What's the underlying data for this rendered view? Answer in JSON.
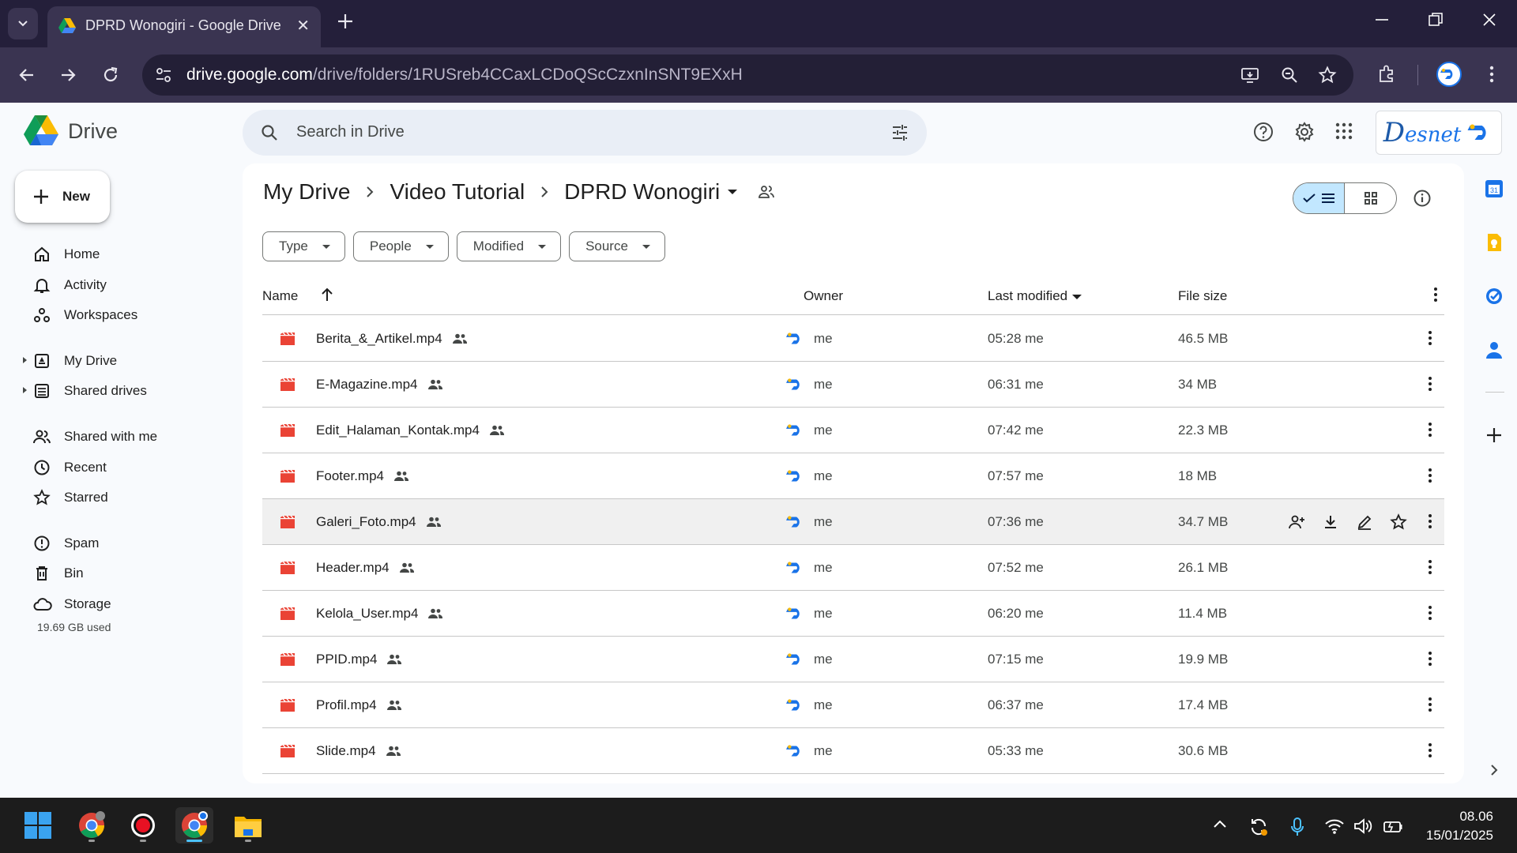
{
  "browser": {
    "tab_title": "DPRD Wonogiri - Google Drive",
    "url_host": "drive.google.com",
    "url_path": "/drive/folders/1RUSreb4CCaxLCDoQScCzxnInSNT9EXxH"
  },
  "drive": {
    "app_name": "Drive",
    "search_placeholder": "Search in Drive",
    "brand_text": "esnet",
    "brand_initial": "D",
    "new_label": "New",
    "nav": [
      {
        "label": "Home",
        "icon": "home-icon"
      },
      {
        "label": "Activity",
        "icon": "bell-icon"
      },
      {
        "label": "Workspaces",
        "icon": "workspaces-icon"
      },
      {
        "label": "My Drive",
        "icon": "my-drive-icon"
      },
      {
        "label": "Shared drives",
        "icon": "shared-drives-icon"
      },
      {
        "label": "Shared with me",
        "icon": "people-icon"
      },
      {
        "label": "Recent",
        "icon": "clock-icon"
      },
      {
        "label": "Starred",
        "icon": "star-icon"
      },
      {
        "label": "Spam",
        "icon": "spam-icon"
      },
      {
        "label": "Bin",
        "icon": "trash-icon"
      },
      {
        "label": "Storage",
        "icon": "cloud-icon"
      }
    ],
    "storage_used": "19.69 GB used",
    "breadcrumb": [
      "My Drive",
      "Video Tutorial",
      "DPRD Wonogiri"
    ],
    "filters": [
      "Type",
      "People",
      "Modified",
      "Source"
    ],
    "columns": {
      "name": "Name",
      "owner": "Owner",
      "modified": "Last modified",
      "size": "File size"
    },
    "files": [
      {
        "name": "Berita_&_Artikel.mp4",
        "owner": "me",
        "modified": "05:28 me",
        "size": "46.5 MB"
      },
      {
        "name": "E-Magazine.mp4",
        "owner": "me",
        "modified": "06:31 me",
        "size": "34 MB"
      },
      {
        "name": "Edit_Halaman_Kontak.mp4",
        "owner": "me",
        "modified": "07:42 me",
        "size": "22.3 MB"
      },
      {
        "name": "Footer.mp4",
        "owner": "me",
        "modified": "07:57 me",
        "size": "18 MB"
      },
      {
        "name": "Galeri_Foto.mp4",
        "owner": "me",
        "modified": "07:36 me",
        "size": "34.7 MB"
      },
      {
        "name": "Header.mp4",
        "owner": "me",
        "modified": "07:52 me",
        "size": "26.1 MB"
      },
      {
        "name": "Kelola_User.mp4",
        "owner": "me",
        "modified": "06:20 me",
        "size": "11.4 MB"
      },
      {
        "name": "PPID.mp4",
        "owner": "me",
        "modified": "07:15 me",
        "size": "19.9 MB"
      },
      {
        "name": "Profil.mp4",
        "owner": "me",
        "modified": "06:37 me",
        "size": "17.4 MB"
      },
      {
        "name": "Slide.mp4",
        "owner": "me",
        "modified": "05:33 me",
        "size": "30.6 MB"
      }
    ],
    "hovered_row": 4,
    "accent": "#0b57d0",
    "file_icon_color": "#ea4335"
  },
  "taskbar": {
    "time": "08.06",
    "date": "15/01/2025"
  }
}
